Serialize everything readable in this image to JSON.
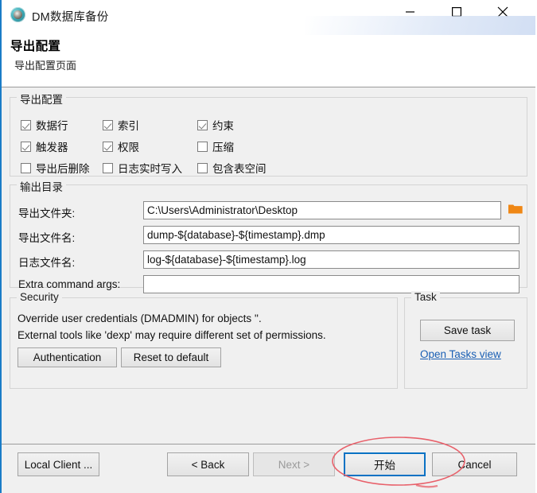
{
  "window": {
    "title": "DM数据库备份",
    "icon": "dm-app-icon",
    "controls": {
      "minimize": "minimize-icon",
      "maximize": "maximize-icon",
      "close": "close-icon"
    }
  },
  "header": {
    "title": "导出配置",
    "subtitle": "导出配置页面"
  },
  "export_group": {
    "legend": "导出配置",
    "checkboxes": [
      {
        "label": "数据行",
        "checked": true
      },
      {
        "label": "索引",
        "checked": true
      },
      {
        "label": "约束",
        "checked": true
      },
      {
        "label": "触发器",
        "checked": true
      },
      {
        "label": "权限",
        "checked": true
      },
      {
        "label": "压缩",
        "checked": false
      },
      {
        "label": "导出后删除",
        "checked": false
      },
      {
        "label": "日志实时写入",
        "checked": false
      },
      {
        "label": "包含表空间",
        "checked": false
      }
    ]
  },
  "output_group": {
    "legend": "输出目录",
    "fields": [
      {
        "label": "导出文件夹:",
        "value": "C:\\Users\\Administrator\\Desktop",
        "placeholder": ""
      },
      {
        "label": "导出文件名:",
        "value": "dump-${database}-${timestamp}.dmp",
        "placeholder": ""
      },
      {
        "label": "日志文件名:",
        "value": "log-${database}-${timestamp}.log",
        "placeholder": ""
      },
      {
        "label": "Extra command args:",
        "value": "",
        "placeholder": ""
      }
    ],
    "browse_icon": "folder-icon",
    "browse_icon_color": "#ef8715"
  },
  "security_group": {
    "legend": "Security",
    "line1": "Override user credentials (DMADMIN) for objects ''.",
    "line2": "External tools like 'dexp' may require different set of permissions.",
    "authentication_label": "Authentication",
    "reset_label": "Reset to default"
  },
  "task_group": {
    "legend": "Task",
    "save_label": "Save task",
    "open_tasks_label": "Open Tasks view",
    "link_color": "#1a5fb4"
  },
  "footer": {
    "local_client_label": "Local Client ...",
    "back_label": "< Back",
    "next_label": "Next >",
    "next_disabled": true,
    "start_label": "开始",
    "cancel_label": "Cancel",
    "focus_color": "#0a72c4"
  },
  "annotation": {
    "shape": "red-ellipse-highlight",
    "color": "#e8606a",
    "targets": "开始"
  }
}
